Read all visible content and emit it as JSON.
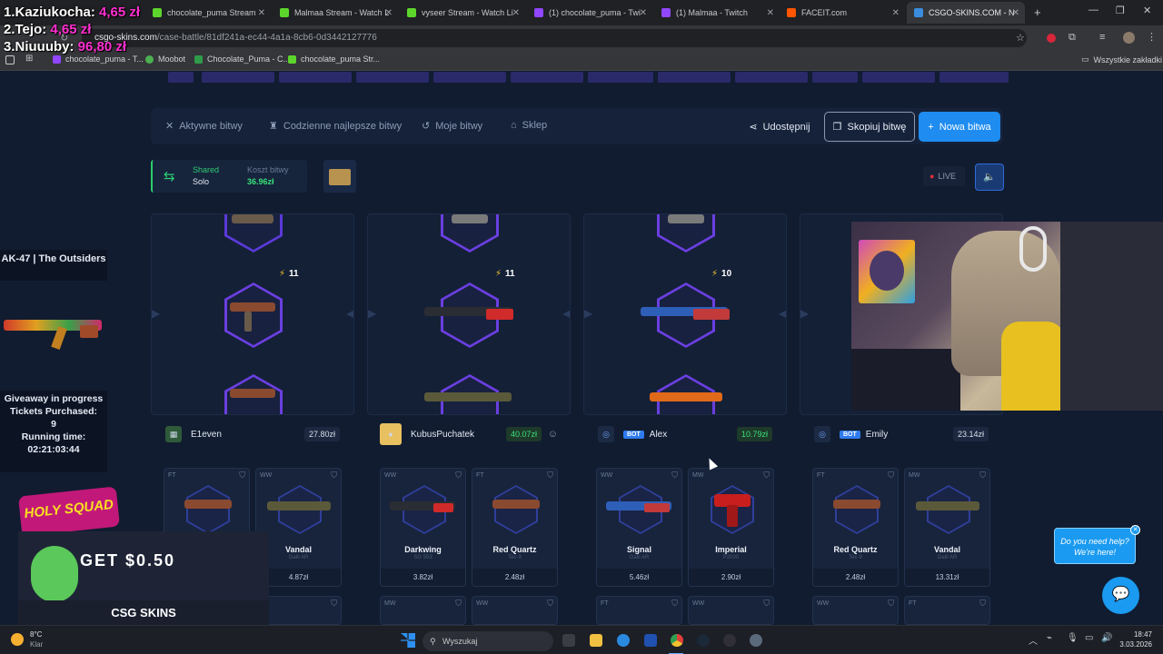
{
  "overlay": {
    "leaderboard": [
      {
        "rank_name": "1.Kaziukocha:",
        "amount": "4,65 zł"
      },
      {
        "rank_name": "2.Tejo:",
        "amount": "4,65 zł"
      },
      {
        "rank_name": "3.Niuuuby:",
        "amount": "96,80 zł"
      }
    ],
    "skin_title": "AK-47 | The Outsiders",
    "giveaway": {
      "status": "Giveaway in progress",
      "tickets_label": "Tickets Purchased:",
      "tickets": "9",
      "running_label": "Running time:",
      "running_time": "02:21:03:44"
    },
    "promo": {
      "squad": "HOLY SQUAD",
      "cta": "GET $0.50",
      "brand": "CSG SKINS"
    }
  },
  "browser": {
    "tabs": [
      {
        "label": "chocolate_puma Stream",
        "color": "#5dd62c"
      },
      {
        "label": "Malmaa Stream - Watch L",
        "color": "#5dd62c"
      },
      {
        "label": "vyseer Stream - Watch Li",
        "color": "#5dd62c"
      },
      {
        "label": "(1) chocolate_puma - Twi",
        "color": "#9146ff"
      },
      {
        "label": "(1) Malmaa - Twitch",
        "color": "#9146ff"
      },
      {
        "label": "FACEIT.com",
        "color": "#ff5500"
      },
      {
        "label": "CSGO-SKINS.COM - N",
        "color": "#3a8dde"
      }
    ],
    "url_host": "csgo-skins.com",
    "url_path": "/case-battle/81df241a-ec44-4a1a-8cb6-0d3442127776",
    "bookmarks": [
      {
        "label": "chocolate_puma - T...",
        "color": "#9146ff"
      },
      {
        "label": "Moobot",
        "color": "#4caf50"
      },
      {
        "label": "Chocolate_Puma - C...",
        "color": "#2e9c4a"
      },
      {
        "label": "chocolate_puma Str...",
        "color": "#5dd62c"
      }
    ],
    "all_bookmarks": "Wszystkie zakładki"
  },
  "nav": {
    "items": [
      "Aktywne bitwy",
      "Codzienne najlepsze bitwy",
      "Moje bitwy",
      "Sklep"
    ],
    "share": "Udostępnij",
    "copy": "Skopiuj bitwę",
    "new": "Nowa bitwa"
  },
  "battle": {
    "mode_top": "Shared",
    "mode_bottom": "Solo",
    "cost_label": "Koszt bitwy",
    "cost": "36.96zł",
    "live": "LIVE"
  },
  "spinners": [
    {
      "count": "11"
    },
    {
      "count": "11"
    },
    {
      "count": "10"
    }
  ],
  "players": [
    {
      "name": "E1even",
      "value": "27.80zł",
      "bot": "",
      "value_color": "gray"
    },
    {
      "name": "KubusPuchatek",
      "value": "40.07zł",
      "bot": "",
      "value_color": "green"
    },
    {
      "name": "Alex",
      "value": "10.79zł",
      "bot": "BOT",
      "value_color": "green"
    },
    {
      "name": "Emily",
      "value": "23.14zł",
      "bot": "BOT",
      "value_color": "gray"
    }
  ],
  "cards": [
    {
      "cond": "FT",
      "name": "",
      "sub": "",
      "price": ""
    },
    {
      "cond": "WW",
      "name": "Vandal",
      "sub": "Galil AR",
      "price": "4.87zł"
    },
    {
      "cond": "WW",
      "name": "Darkwing",
      "sub": "SG 553",
      "price": "3.82zł"
    },
    {
      "cond": "FT",
      "name": "Red Quartz",
      "sub": "Tec-9",
      "price": "2.48zł"
    },
    {
      "cond": "WW",
      "name": "Signal",
      "sub": "Galil AR",
      "price": "5.46zł"
    },
    {
      "cond": "MW",
      "name": "Imperial",
      "sub": "P2000",
      "price": "2.90zł"
    },
    {
      "cond": "FT",
      "name": "Red Quartz",
      "sub": "Tec-9",
      "price": "2.48zł"
    },
    {
      "cond": "MW",
      "name": "Vandal",
      "sub": "Galil AR",
      "price": "13.31zł"
    }
  ],
  "cards_row2": [
    "",
    "",
    "MW",
    "WW",
    "FT",
    "WW",
    "WW",
    "FT"
  ],
  "help": {
    "line1": "Do you need help?",
    "line2": "We're here!"
  },
  "taskbar": {
    "temp": "8°C",
    "weather": "Klar",
    "search": "Wyszukaj",
    "time": "18:47",
    "date": "3.03.2026"
  }
}
